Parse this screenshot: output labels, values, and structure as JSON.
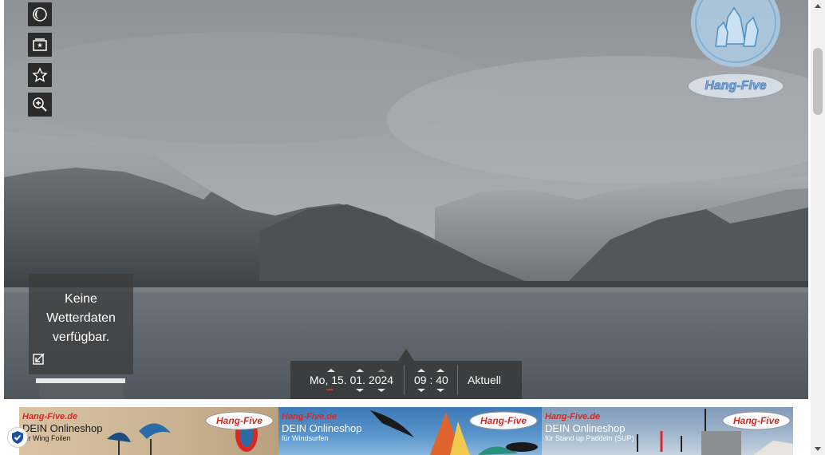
{
  "toolbar": {
    "items": [
      {
        "name": "history-icon"
      },
      {
        "name": "gallery-icon"
      },
      {
        "name": "favorite-star-icon"
      },
      {
        "name": "zoom-in-icon"
      }
    ]
  },
  "weather": {
    "line1": "Keine",
    "line2": "Wetterdaten",
    "line3": "verfügbar.",
    "icon": "expand-arrow-icon"
  },
  "datetime": {
    "weekday_day": "Mo, 15",
    "dot1": ".",
    "month": " 01",
    "dot2": ".",
    "year": " 2024",
    "hour": "09",
    "colon": " : ",
    "minute": "40",
    "now_label": "Aktuell"
  },
  "logos": {
    "crystal": "crystal-logo",
    "brand": "Hang-Five"
  },
  "ads": [
    {
      "brand": "Hang-Five.de",
      "line1": "DEIN Onlineshop",
      "line2": "für Wing Foilen"
    },
    {
      "brand": "Hang-Five.de",
      "line1": "DEIN Onlineshop",
      "line2": "für Windsurfen"
    },
    {
      "brand": "Hang-Five.de",
      "line1": "DEIN Onlineshop",
      "line2": "für Stand up Paddeln (SUP)"
    }
  ],
  "ad_logo_text": "Hang-Five",
  "colors": {
    "accent_red": "#d62a24",
    "panel": "#373737",
    "scroll_thumb": "#c1c1c1"
  }
}
